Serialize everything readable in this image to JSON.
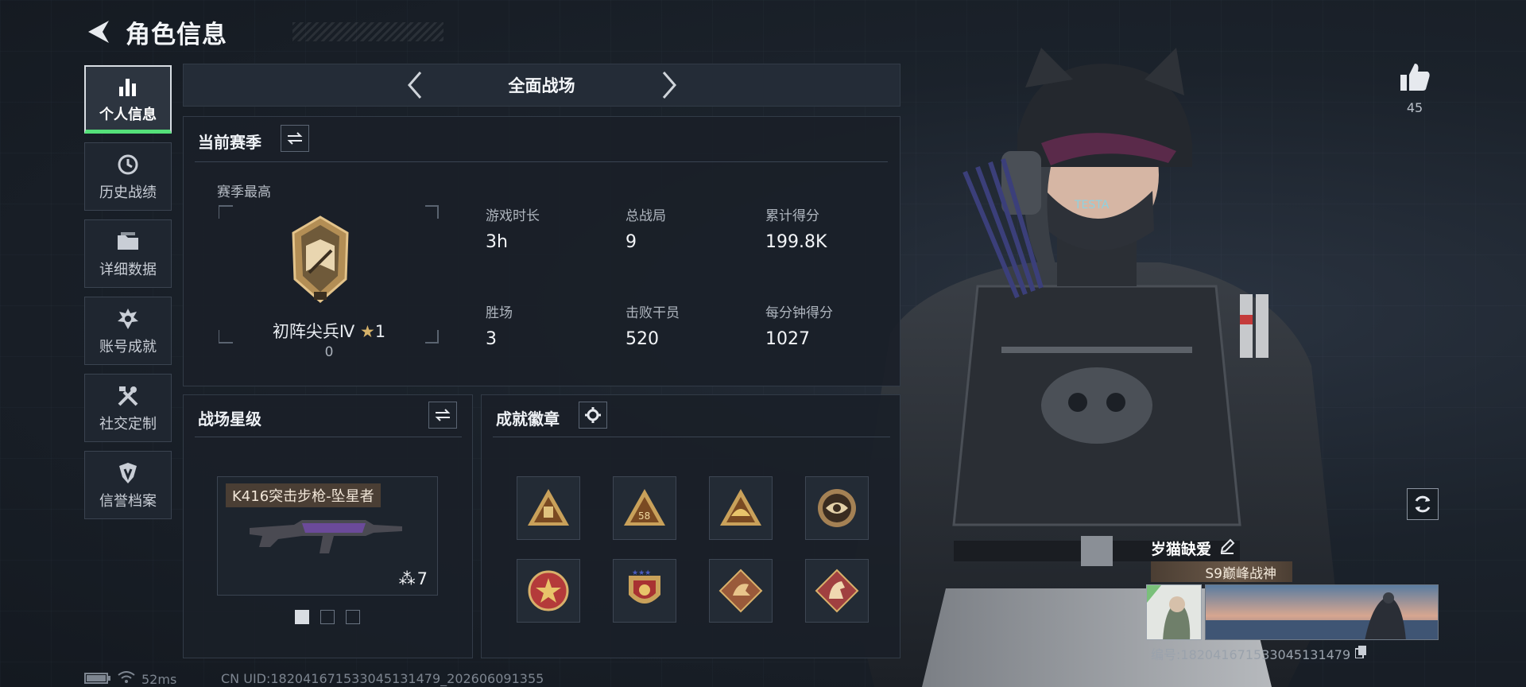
{
  "header": {
    "title": "角色信息"
  },
  "sidebar": {
    "items": [
      {
        "label": "个人信息",
        "icon": "bar-chart-icon",
        "active": true
      },
      {
        "label": "历史战绩",
        "icon": "history-clock-icon"
      },
      {
        "label": "详细数据",
        "icon": "folder-icon"
      },
      {
        "label": "账号成就",
        "icon": "achievement-icon"
      },
      {
        "label": "社交定制",
        "icon": "tools-icon"
      },
      {
        "label": "信誉档案",
        "icon": "shield-gem-icon"
      }
    ]
  },
  "mode": {
    "title": "全面战场"
  },
  "season": {
    "title": "当前赛季",
    "best_label": "赛季最高",
    "rank_name": "初阵尖兵Ⅳ",
    "rank_star_count": "1",
    "rank_points": "0",
    "stats": [
      {
        "label": "游戏时长",
        "value": "3h"
      },
      {
        "label": "总战局",
        "value": "9"
      },
      {
        "label": "累计得分",
        "value": "199.8K"
      },
      {
        "label": "胜场",
        "value": "3"
      },
      {
        "label": "击败干员",
        "value": "520"
      },
      {
        "label": "每分钟得分",
        "value": "1027"
      }
    ]
  },
  "battle_star": {
    "title": "战场星级",
    "weapon_name": "K416突击步枪-坠星者",
    "star_level": "7",
    "pages": 3,
    "current_page": 1
  },
  "achievements": {
    "title": "成就徽章",
    "badges": [
      "triangle-badge-1",
      "triangle-badge-58",
      "triangle-badge-3",
      "eye-badge",
      "star-round-badge",
      "shield-star-badge",
      "dragon-diamond-badge",
      "horse-diamond-badge"
    ]
  },
  "profile": {
    "likes": "45",
    "player_name": "岁猫缺爱",
    "title_plate": "S9巅峰战神",
    "uid_label": "编号:182041671533045131479"
  },
  "status": {
    "ping": "52ms",
    "cn_uid": "CN UID:182041671533045131479_202606091355"
  },
  "colors": {
    "accent_green": "#55e07a",
    "panel_bg": "#1a2028",
    "gold": "#c9a15a"
  }
}
